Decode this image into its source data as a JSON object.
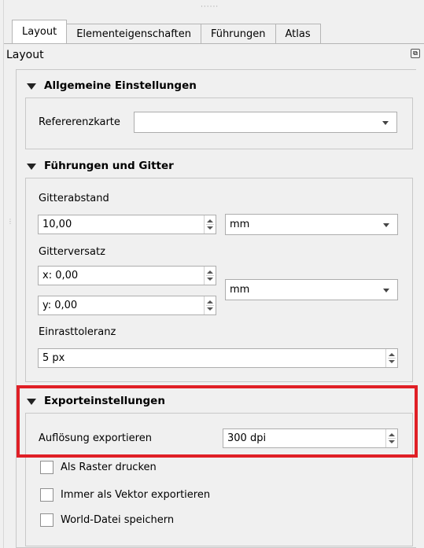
{
  "tabs": [
    {
      "label": "Layout",
      "active": true
    },
    {
      "label": "Elementeigenschaften",
      "active": false
    },
    {
      "label": "Führungen",
      "active": false
    },
    {
      "label": "Atlas",
      "active": false
    }
  ],
  "panel": {
    "title": "Layout"
  },
  "general": {
    "title": "Allgemeine Einstellungen",
    "reference_map_label": "Refererenzkarte",
    "reference_map_value": ""
  },
  "guides": {
    "title": "Führungen und Gitter",
    "grid_spacing_label": "Gitterabstand",
    "grid_spacing_value": "10,00",
    "grid_spacing_unit": "mm",
    "grid_offset_label": "Gitterversatz",
    "offset_x_value": "x: 0,00",
    "offset_y_value": "y: 0,00",
    "offset_unit": "mm",
    "snap_tolerance_label": "Einrasttoleranz",
    "snap_tolerance_value": "5 px"
  },
  "export": {
    "title": "Exporteinstellungen",
    "resolution_label": "Auflösung exportieren",
    "resolution_value": "300 dpi",
    "print_as_raster_label": "Als Raster drucken",
    "print_as_raster_checked": false,
    "always_vector_label": "Immer als Vektor exportieren",
    "always_vector_checked": false,
    "save_world_file_label": "World-Datei speichern",
    "save_world_file_checked": false
  },
  "colors": {
    "highlight": "#e01f26",
    "window_bg": "#f0f0f0"
  }
}
